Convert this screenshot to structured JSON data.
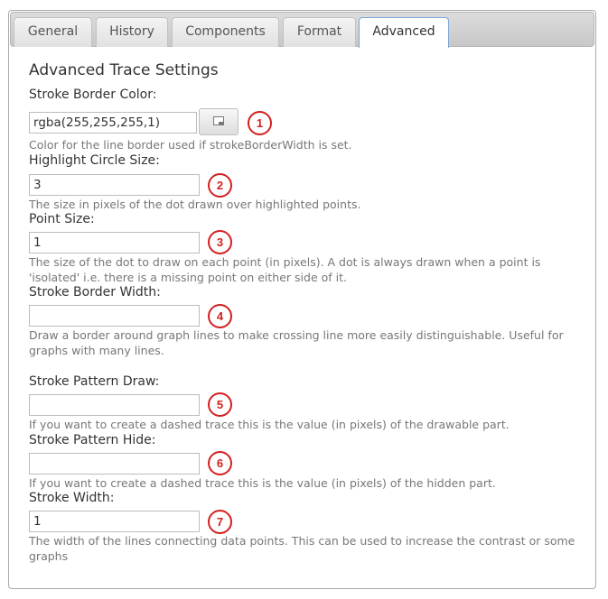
{
  "tabs": [
    {
      "label": "General"
    },
    {
      "label": "History"
    },
    {
      "label": "Components"
    },
    {
      "label": "Format"
    },
    {
      "label": "Advanced"
    }
  ],
  "active_tab": "Advanced",
  "section_title": "Advanced Trace Settings",
  "fields": {
    "stroke_border_color": {
      "label": "Stroke Border Color:",
      "value": "rgba(255,255,255,1)",
      "description": "Color for the line border used if strokeBorderWidth is set.",
      "badge": "1"
    },
    "highlight_circle_size": {
      "label": "Highlight Circle Size:",
      "value": "3",
      "description": "The size in pixels of the dot drawn over highlighted points.",
      "badge": "2"
    },
    "point_size": {
      "label": "Point Size:",
      "value": "1",
      "description": "The size of the dot to draw on each point (in pixels). A dot is always drawn when a point is 'isolated' i.e. there is a missing point on either side of it.",
      "badge": "3"
    },
    "stroke_border_width": {
      "label": "Stroke Border Width:",
      "value": "",
      "description": "Draw a border around graph lines to make crossing line more easily distinguishable. Useful for graphs with many lines.",
      "badge": "4"
    },
    "stroke_pattern_draw": {
      "label": "Stroke Pattern Draw:",
      "value": "",
      "description": "If you want to create a dashed trace this is the value (in pixels) of the drawable part.",
      "badge": "5"
    },
    "stroke_pattern_hide": {
      "label": "Stroke Pattern Hide:",
      "value": "",
      "description": "If you want to create a dashed trace this is the value (in pixels) of the hidden part.",
      "badge": "6"
    },
    "stroke_width": {
      "label": "Stroke Width:",
      "value": "1",
      "description": "The width of the lines connecting data points. This can be used to increase the contrast or some graphs",
      "badge": "7"
    }
  },
  "colors": {
    "badge": "#d32020",
    "active_tab_border": "#79a7d8",
    "description_text": "#777777"
  },
  "icons": {
    "color_picker": "color-picker-icon"
  }
}
